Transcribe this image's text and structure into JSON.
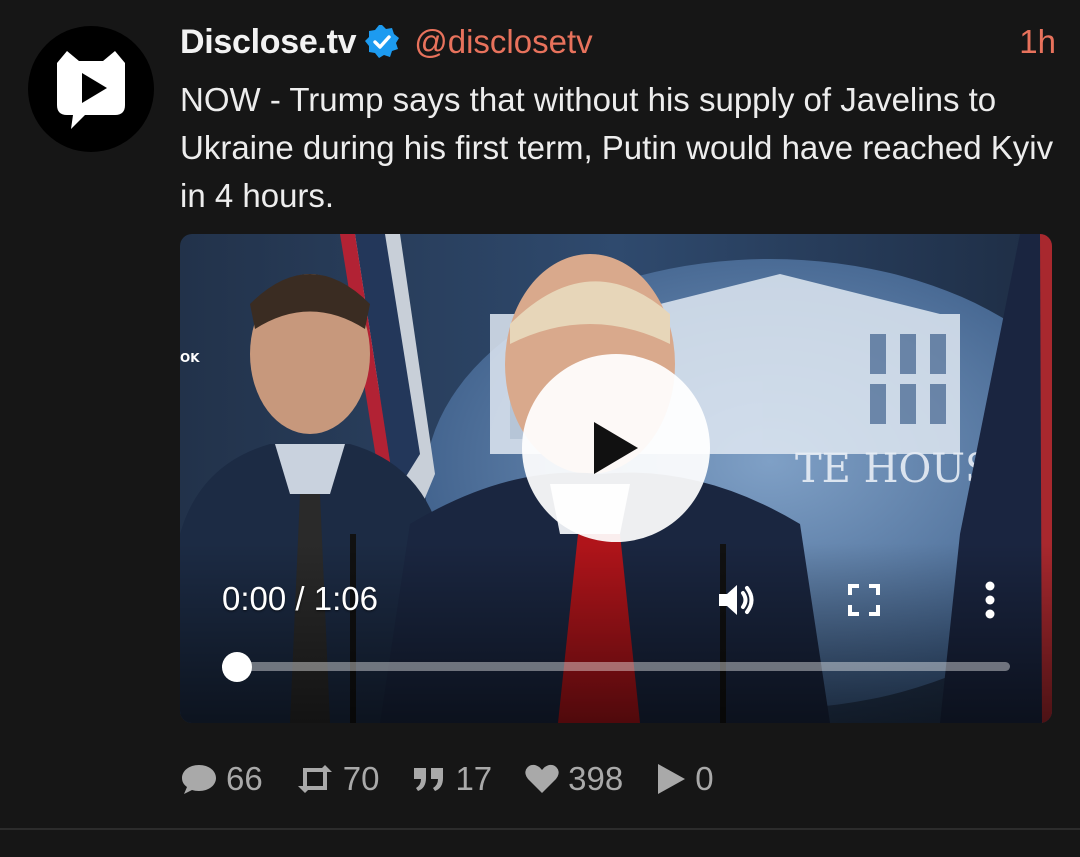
{
  "post": {
    "display_name": "Disclose.tv",
    "handle": "@disclosetv",
    "time": "1h",
    "text": "NOW - Trump says that without his supply of Javelins to Ukraine during his first term, Putin would have reached Kyiv in 4 hours.",
    "verified_icon": "verified-badge-icon",
    "avatar_icon": "disclose-tv-logo"
  },
  "video": {
    "current_time": "0:00 / 1:06",
    "progress": 0.0,
    "overlay_text_visible": "TE HOUSE",
    "side_text": "OK",
    "icons": [
      "play-icon",
      "volume-icon",
      "fullscreen-icon",
      "more-options-icon"
    ]
  },
  "stats": {
    "replies": "66",
    "reposts": "70",
    "quotes": "17",
    "likes": "398",
    "plays": "0"
  },
  "colors": {
    "background": "#161616",
    "accent": "#e8725c",
    "verified": "#1d9bf0",
    "stat_text": "#a9a9a9"
  }
}
